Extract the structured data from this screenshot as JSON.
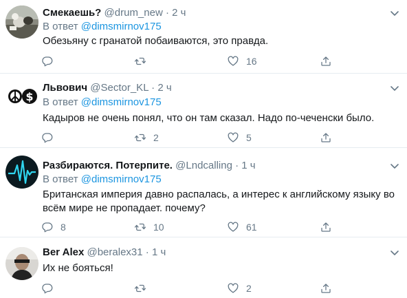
{
  "reply_prefix": "В ответ",
  "tweets": [
    {
      "name": "Смекаешь?",
      "handle": "@drum_new",
      "time": "2 ч",
      "mention": "@dimsmirnov175",
      "text": "Обезьяну с гранатой побаиваются, это правда.",
      "replies": "",
      "retweets": "",
      "likes": "16",
      "avatar_icon": "photo-avatar-icon"
    },
    {
      "name": "Львович",
      "handle": "@Sector_KL",
      "time": "2 ч",
      "mention": "@dimsmirnov175",
      "text": "Кадыров не очень понял, что он там сказал. Надо по-чеченски было.",
      "replies": "",
      "retweets": "2",
      "likes": "5",
      "avatar_icon": "peace-dollar-icon"
    },
    {
      "name": "Разбираются. Потерпите.",
      "handle": "@Lndcalling",
      "time": "1 ч",
      "mention": "@dimsmirnov175",
      "text": "Британская империя давно распалась, а интерес к английскому языку во всём мире не пропадает. почему?",
      "replies": "8",
      "retweets": "10",
      "likes": "61",
      "avatar_icon": "waveform-icon"
    },
    {
      "name": "Ber Alex",
      "handle": "@beralex31",
      "time": "1 ч",
      "mention": "",
      "text": "Их не бояться!",
      "replies": "",
      "retweets": "",
      "likes": "2",
      "avatar_icon": "person-photo-icon"
    }
  ],
  "colors": {
    "link": "#1b95e0",
    "secondary": "#657786",
    "divider": "#e6ecf0",
    "text": "#14171a"
  }
}
